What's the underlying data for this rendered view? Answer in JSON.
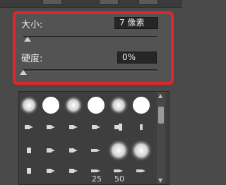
{
  "brush_settings": {
    "size_label": "大小:",
    "size_value": "7 像素",
    "size_slider_level": 0.03,
    "hardness_label": "硬度:",
    "hardness_value": "0%",
    "hardness_slider_level": 0.0
  },
  "preset_picker": {
    "rows": [
      [
        "soft-round-brush",
        "hard-round-brush",
        "soft-round-brush",
        "hard-round-brush",
        "soft-round-brush",
        "hard-round-brush"
      ],
      [
        "chalk-brush",
        "chalk-brush",
        "chalk-brush",
        "chalk-brush",
        "star-brush",
        "charcoal-brush"
      ],
      [
        "square-brush",
        "chalk-brush",
        "chalk-brush",
        "dry-brush",
        "soft-round-brush",
        "soft-round-brush"
      ],
      [
        "square-brush",
        "chalk-brush",
        "chalk-brush",
        "dry-brush",
        "dry-brush",
        "dry-brush"
      ]
    ],
    "size_labels": [
      "25",
      "50"
    ],
    "scroll_up": "▲",
    "scroll_down": "▼"
  },
  "colors": {
    "highlight_border": "#e2262b",
    "panel_bg": "#535353"
  }
}
